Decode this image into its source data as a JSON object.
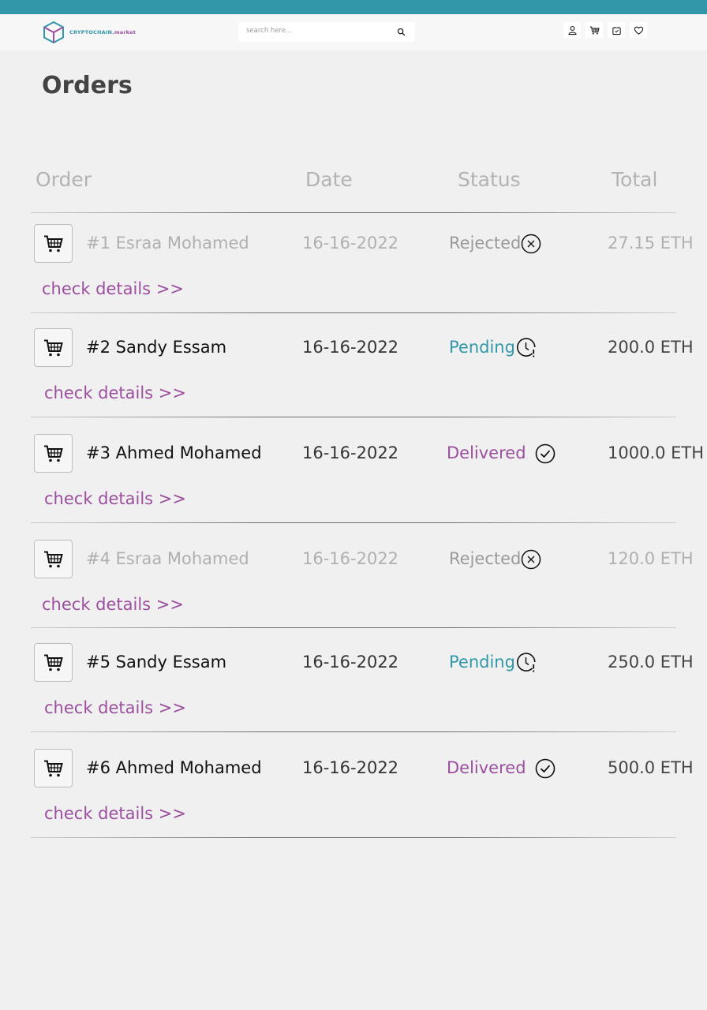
{
  "brand": {
    "name_part1": "CRYPTOCHAIN",
    "name_part2": ".market",
    "primary": "#3197a9",
    "accent": "#9b4f9e"
  },
  "search": {
    "placeholder": "search here..."
  },
  "header_icons": [
    "user-icon",
    "cart-icon",
    "bag-icon",
    "heart-icon"
  ],
  "page_title": "Orders",
  "columns": {
    "order": "Order",
    "date": "Date",
    "status": "Status",
    "total": "Total"
  },
  "orders": [
    {
      "name": "#1 Esraa Mohamed",
      "date": "16-16-2022",
      "status": "Rejected",
      "total": "27.15 ETH",
      "link": "check details >>"
    },
    {
      "name": "#2 Sandy Essam",
      "date": "16-16-2022",
      "status": "Pending",
      "total": "200.0 ETH",
      "link": "check details >>"
    },
    {
      "name": "#3 Ahmed Mohamed",
      "date": "16-16-2022",
      "status": "Delivered",
      "total": "1000.0 ETH",
      "link": "check details >>"
    },
    {
      "name": "#4 Esraa Mohamed",
      "date": "16-16-2022",
      "status": "Rejected",
      "total": "120.0 ETH",
      "link": "check details >>"
    },
    {
      "name": "#5 Sandy Essam",
      "date": "16-16-2022",
      "status": "Pending",
      "total": "250.0 ETH",
      "link": "check details >>"
    },
    {
      "name": "#6 Ahmed Mohamed",
      "date": "16-16-2022",
      "status": "Delivered",
      "total": "500.0 ETH",
      "link": "check details >>"
    }
  ]
}
